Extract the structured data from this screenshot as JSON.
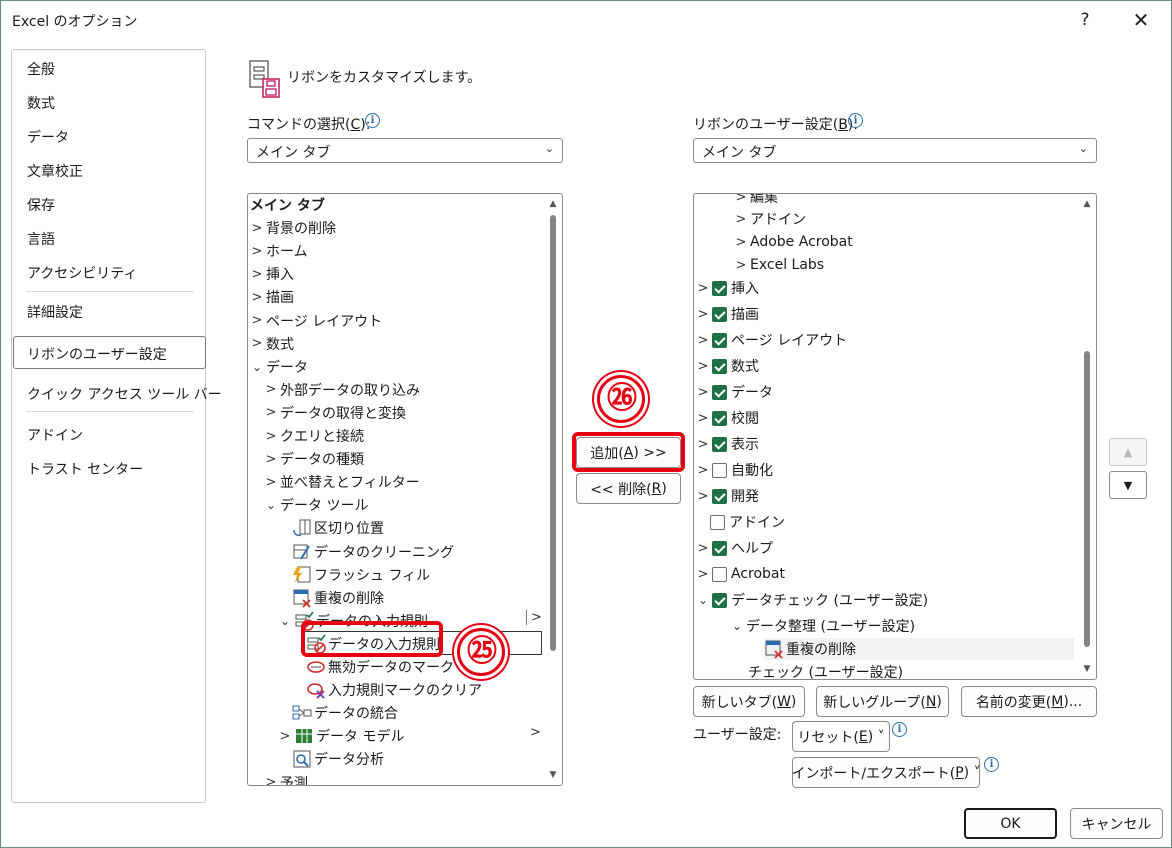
{
  "window": {
    "title": "Excel のオプション",
    "help_glyph": "?",
    "close_glyph": "✕"
  },
  "nav": {
    "items": [
      "全般",
      "数式",
      "データ",
      "文章校正",
      "保存",
      "言語",
      "アクセシビリティ",
      "詳細設定",
      "リボンのユーザー設定",
      "クイック アクセス ツール バー",
      "アドイン",
      "トラスト センター"
    ],
    "selected": "リボンのユーザー設定"
  },
  "header": {
    "text": "リボンをカスタマイズします。"
  },
  "left": {
    "label_pre": "コマンドの選択(",
    "label_key": "C",
    "label_post": "):",
    "dropdown_value": "メイン タブ",
    "tree": [
      {
        "text": "メイン タブ",
        "bold": true
      },
      {
        "text": "背景の削除"
      },
      {
        "text": "ホーム"
      },
      {
        "text": "挿入"
      },
      {
        "text": "描画"
      },
      {
        "text": "ページ レイアウト"
      },
      {
        "text": "数式"
      },
      {
        "text": "データ"
      },
      {
        "text": "外部データの取り込み"
      },
      {
        "text": "データの取得と変換"
      },
      {
        "text": "クエリと接続"
      },
      {
        "text": "データの種類"
      },
      {
        "text": "並べ替えとフィルター"
      },
      {
        "text": "データ ツール"
      },
      {
        "text": "区切り位置"
      },
      {
        "text": "データのクリーニング"
      },
      {
        "text": "フラッシュ フィル"
      },
      {
        "text": "重複の削除"
      },
      {
        "text": "データの入力規則"
      },
      {
        "text": "データの入力規則"
      },
      {
        "text": "無効データのマーク"
      },
      {
        "text": "入力規則マークのクリア"
      },
      {
        "text": "データの統合"
      },
      {
        "text": "データ モデル"
      },
      {
        "text": "データ分析"
      },
      {
        "text": "予測"
      }
    ]
  },
  "middle": {
    "add_pre": "追加(",
    "add_key": "A",
    "add_post": ") >>",
    "remove_pre": "<< 削除(",
    "remove_key": "R",
    "remove_post": ")",
    "badge_25": "㉕",
    "badge_26": "㉖"
  },
  "right": {
    "label_pre": "リボンのユーザー設定(",
    "label_key": "B",
    "label_post": "):",
    "dropdown_value": "メイン タブ",
    "tree": [
      {
        "text": "編集"
      },
      {
        "text": "アドイン"
      },
      {
        "text": "Adobe Acrobat"
      },
      {
        "text": "Excel Labs"
      },
      {
        "text": "挿入",
        "checked": true
      },
      {
        "text": "描画",
        "checked": true
      },
      {
        "text": "ページ レイアウト",
        "checked": true
      },
      {
        "text": "数式",
        "checked": true
      },
      {
        "text": "データ",
        "checked": true
      },
      {
        "text": "校閲",
        "checked": true
      },
      {
        "text": "表示",
        "checked": true
      },
      {
        "text": "自動化",
        "checked": false
      },
      {
        "text": "開発",
        "checked": true
      },
      {
        "text": "アドイン",
        "checked": false
      },
      {
        "text": "ヘルプ",
        "checked": true
      },
      {
        "text": "Acrobat",
        "checked": false
      },
      {
        "text": "データチェック (ユーザー設定)",
        "checked": true
      },
      {
        "text": "データ整理 (ユーザー設定)"
      },
      {
        "text": "重複の削除"
      },
      {
        "text": "チェック (ユーザー設定)"
      }
    ],
    "new_tab_pre": "新しいタブ(",
    "new_tab_key": "W",
    "new_tab_post": ")",
    "new_group_pre": "新しいグループ(",
    "new_group_key": "N",
    "new_group_post": ")",
    "rename_pre": "名前の変更(",
    "rename_key": "M",
    "rename_post": ")...",
    "custom_label": "ユーザー設定:",
    "reset_pre": "リセット(",
    "reset_key": "E",
    "reset_post": ") ˅",
    "import_pre": "インポート/エクスポート(",
    "import_key": "P",
    "import_post": ") ˅"
  },
  "footer": {
    "ok": "OK",
    "cancel": "キャンセル"
  }
}
